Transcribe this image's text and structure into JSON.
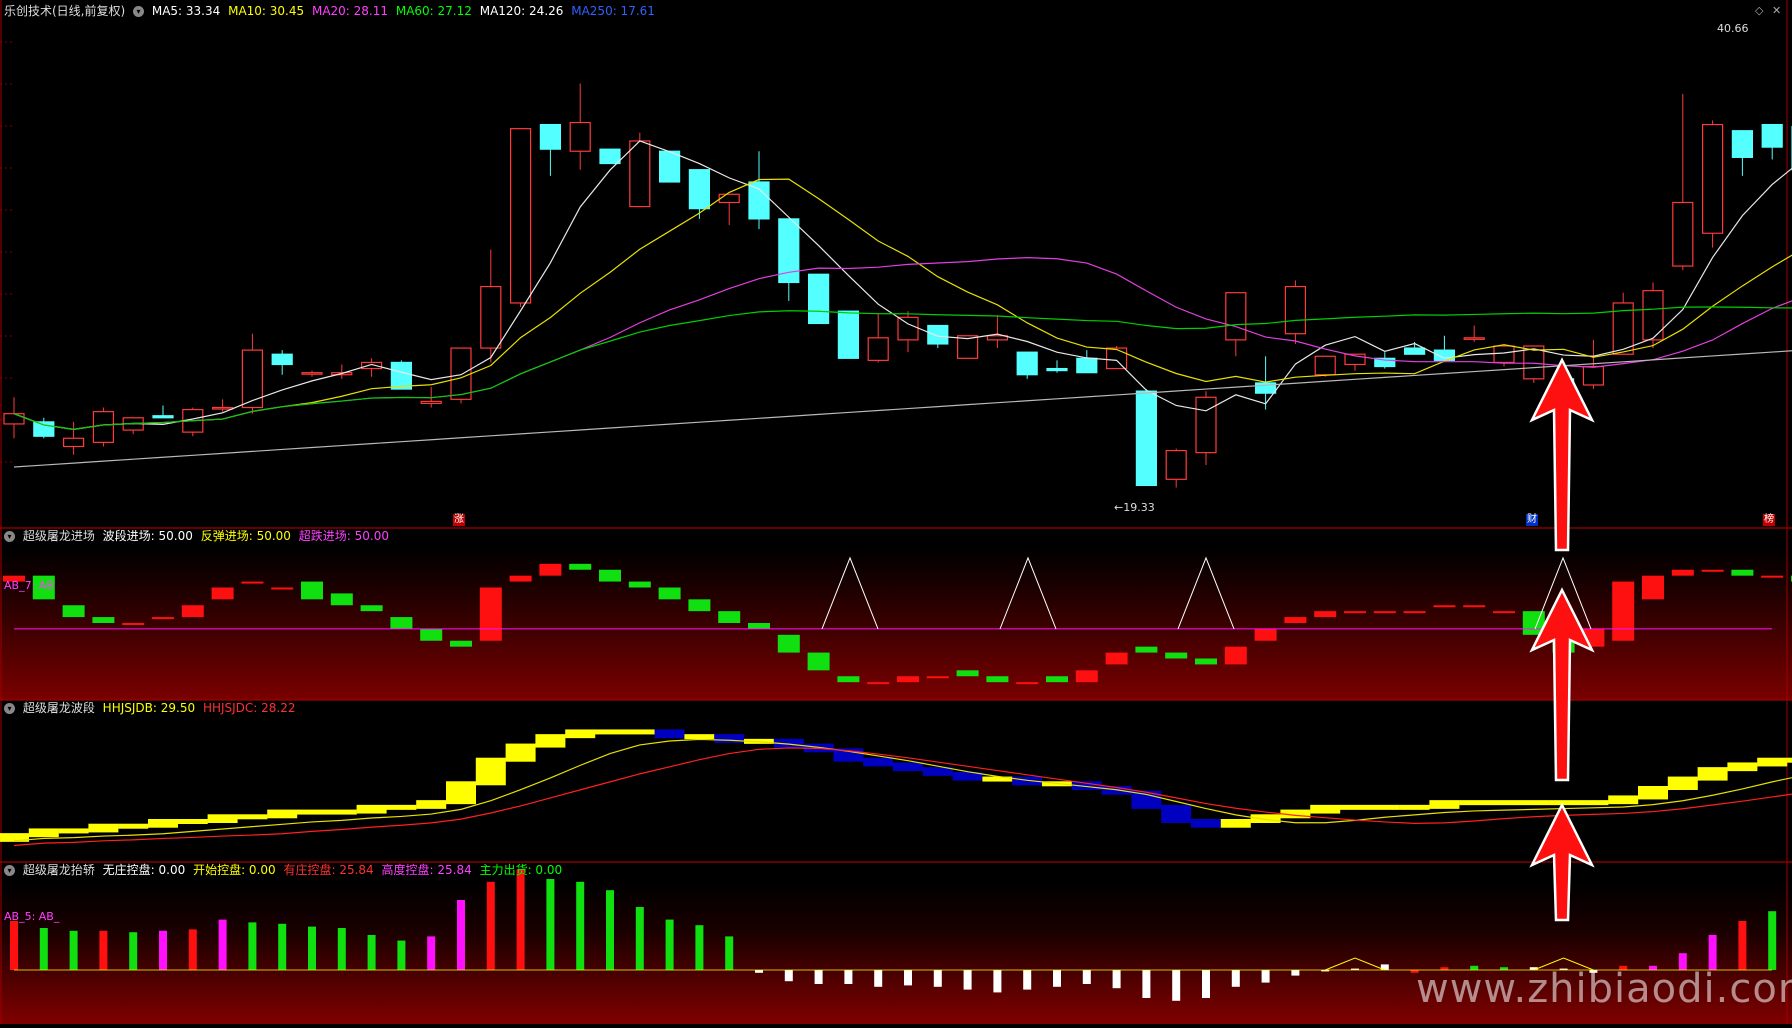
{
  "colors": {
    "up": "#ff3a3a",
    "down": "#54ffff",
    "ma5": "#e8e8e8",
    "ma10": "#e8e000",
    "ma20": "#e040e0",
    "ma60": "#00d000",
    "ma120": "#b8b8b8",
    "ma250": "#2040ff",
    "panel_border": "#a00000",
    "red_bar": "#ff1010",
    "green_bar": "#10e010",
    "magenta_bar": "#ff10ff",
    "yellow": "#ffff00",
    "blue": "#0000c0"
  },
  "main": {
    "title": "乐创技术(日线,前复权)",
    "ma": [
      {
        "label": "MA5: 33.34",
        "color": "#ffffff"
      },
      {
        "label": "MA10: 30.45",
        "color": "#ffff00"
      },
      {
        "label": "MA20: 28.11",
        "color": "#ff40ff"
      },
      {
        "label": "MA60: 27.12",
        "color": "#00ff00"
      },
      {
        "label": "MA120: 24.26",
        "color": "#ffffff"
      },
      {
        "label": "MA250: 17.61",
        "color": "#3060ff"
      }
    ],
    "high_label": "40.66",
    "low_label": "←19.33",
    "markers": [
      "涨",
      "财",
      "榜"
    ]
  },
  "panel2": {
    "title": "超级屠龙进场",
    "items": [
      {
        "label": "波段进场: 50.00",
        "color": "#ffffff"
      },
      {
        "label": "反弹进场: 50.00",
        "color": "#ffff00"
      },
      {
        "label": "超跌进场: 50.00",
        "color": "#ff40ff"
      }
    ],
    "side_label": "AB_7: AB"
  },
  "panel3": {
    "title": "超级屠龙波段",
    "items": [
      {
        "label": "HHJSJDB: 29.50",
        "color": "#ffff00"
      },
      {
        "label": "HHJSJDC: 28.22",
        "color": "#ff3030"
      }
    ]
  },
  "panel4": {
    "title": "超级屠龙抬轿",
    "items": [
      {
        "label": "无庄控盘: 0.00",
        "color": "#ffffff"
      },
      {
        "label": "开始控盘: 0.00",
        "color": "#ffff00"
      },
      {
        "label": "有庄控盘: 25.84",
        "color": "#ff3030"
      },
      {
        "label": "高度控盘: 25.84",
        "color": "#ff40ff"
      },
      {
        "label": "主力出货: 0.00",
        "color": "#00ff00"
      }
    ],
    "side_label": "AB_5: AB_"
  },
  "watermark": "www.zhibiaodi.com",
  "chart_data": {
    "type": "candlestick",
    "ohlc": [
      [
        22.3,
        23.6,
        21.6,
        22.8
      ],
      [
        22.4,
        22.6,
        21.6,
        21.7
      ],
      [
        21.2,
        22.4,
        20.8,
        21.6
      ],
      [
        21.4,
        23.1,
        21.2,
        22.9
      ],
      [
        22.0,
        22.5,
        21.8,
        22.6
      ],
      [
        22.7,
        23.2,
        22.6,
        22.6
      ],
      [
        21.9,
        23.1,
        21.7,
        23.0
      ],
      [
        23.1,
        23.5,
        22.9,
        23.1
      ],
      [
        23.1,
        26.7,
        22.8,
        25.9
      ],
      [
        25.7,
        25.9,
        24.7,
        25.2
      ],
      [
        24.8,
        24.9,
        24.6,
        24.8
      ],
      [
        24.7,
        25.2,
        24.5,
        24.8
      ],
      [
        25.0,
        25.5,
        24.6,
        25.3
      ],
      [
        25.3,
        25.4,
        24.1,
        24.0
      ],
      [
        23.3,
        24.1,
        23.1,
        23.4
      ],
      [
        23.5,
        25.6,
        23.3,
        26.0
      ],
      [
        26.0,
        30.8,
        25.3,
        29.0
      ],
      [
        28.2,
        36.4,
        28.0,
        36.7
      ],
      [
        36.9,
        36.4,
        34.4,
        35.7
      ],
      [
        35.6,
        38.9,
        34.7,
        37.0
      ],
      [
        35.7,
        35.4,
        35.3,
        35.0
      ],
      [
        32.9,
        36.5,
        32.9,
        36.1
      ],
      [
        35.6,
        34.4,
        34.4,
        34.1
      ],
      [
        34.7,
        34.6,
        32.3,
        32.8
      ],
      [
        33.1,
        33.4,
        32.0,
        33.5
      ],
      [
        34.1,
        35.6,
        31.8,
        32.3
      ],
      [
        32.3,
        29.8,
        28.3,
        29.2
      ],
      [
        29.6,
        28.0,
        27.2,
        27.2
      ],
      [
        27.8,
        25.6,
        25.5,
        25.5
      ],
      [
        25.4,
        27.7,
        25.3,
        26.5
      ],
      [
        26.4,
        27.8,
        25.8,
        27.5
      ],
      [
        27.1,
        26.9,
        26.0,
        26.2
      ],
      [
        25.5,
        26.6,
        25.5,
        26.6
      ],
      [
        26.4,
        27.6,
        26.0,
        26.6
      ],
      [
        25.8,
        25.5,
        24.5,
        24.7
      ],
      [
        25.0,
        25.4,
        24.8,
        24.9
      ],
      [
        25.5,
        25.9,
        24.9,
        24.8
      ],
      [
        25.0,
        26.1,
        25.3,
        26.0
      ],
      [
        23.9,
        24.0,
        19.9,
        19.3
      ],
      [
        19.6,
        21.1,
        19.2,
        21.0
      ],
      [
        20.9,
        23.9,
        20.3,
        23.6
      ],
      [
        26.4,
        28.5,
        25.6,
        28.7
      ],
      [
        24.3,
        25.6,
        23.0,
        23.8
      ],
      [
        26.7,
        29.3,
        26.2,
        29.0
      ],
      [
        24.7,
        25.3,
        24.6,
        25.6
      ],
      [
        25.2,
        25.4,
        24.9,
        25.7
      ],
      [
        25.5,
        25.8,
        25.0,
        25.1
      ],
      [
        26.0,
        26.3,
        25.9,
        25.7
      ],
      [
        25.9,
        26.6,
        25.6,
        25.4
      ],
      [
        26.5,
        27.1,
        26.3,
        26.5
      ],
      [
        25.3,
        26.0,
        25.1,
        26.1
      ],
      [
        24.5,
        26.0,
        24.3,
        26.1
      ],
      [
        24.5,
        25.3,
        24.2,
        24.2
      ],
      [
        24.2,
        26.4,
        24.0,
        25.1
      ],
      [
        25.7,
        28.7,
        25.7,
        28.2
      ],
      [
        26.4,
        29.2,
        26.0,
        28.8
      ],
      [
        30.0,
        38.4,
        29.8,
        33.1
      ],
      [
        31.6,
        37.1,
        30.9,
        36.9
      ],
      [
        36.6,
        36.2,
        34.4,
        35.3
      ],
      [
        36.9,
        35.3,
        35.2,
        35.8
      ],
      [
        36.8,
        36.7,
        34.6,
        34.7
      ],
      [
        34.5,
        34.4,
        33.9,
        34.0
      ],
      [
        33.0,
        40.7,
        32.9,
        39.1
      ]
    ],
    "ylim": [
      18.2,
      42.0
    ]
  }
}
